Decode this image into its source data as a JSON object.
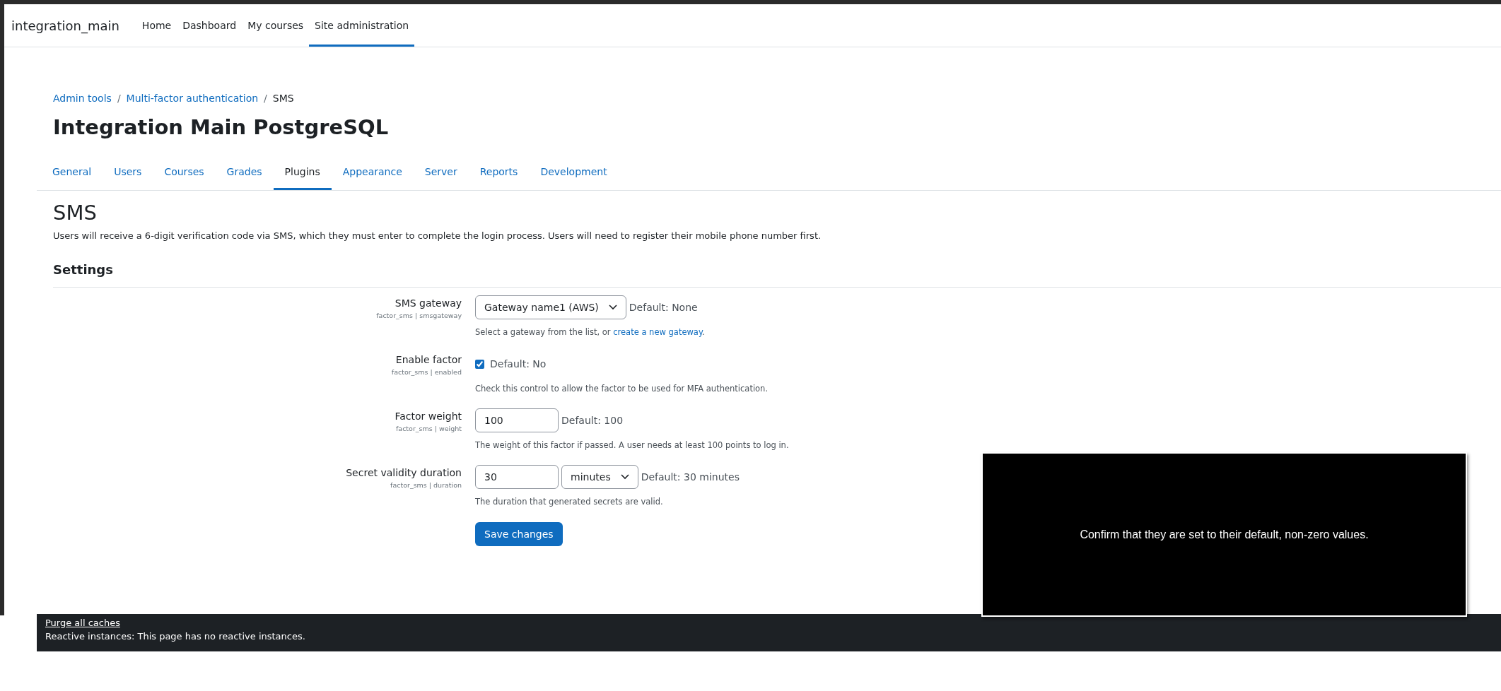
{
  "navbar": {
    "brand": "integration_main",
    "items": [
      {
        "label": "Home",
        "selected": false
      },
      {
        "label": "Dashboard",
        "selected": false
      },
      {
        "label": "My courses",
        "selected": false
      },
      {
        "label": "Site administration",
        "selected": true
      }
    ]
  },
  "breadcrumb": [
    {
      "label": "Admin tools",
      "link": true
    },
    {
      "separator": "/",
      "label": "Multi-factor authentication",
      "link": true
    },
    {
      "separator": "/",
      "label": "SMS",
      "link": false
    }
  ],
  "page_title": "Integration Main PostgreSQL",
  "tabs": [
    {
      "label": "General",
      "selected": false
    },
    {
      "label": "Users",
      "selected": false
    },
    {
      "label": "Courses",
      "selected": false
    },
    {
      "label": "Grades",
      "selected": false
    },
    {
      "label": "Plugins",
      "selected": true
    },
    {
      "label": "Appearance",
      "selected": false
    },
    {
      "label": "Server",
      "selected": false
    },
    {
      "label": "Reports",
      "selected": false
    },
    {
      "label": "Development",
      "selected": false
    }
  ],
  "heading": "SMS",
  "description": "Users will receive a 6-digit verification code via SMS, which they must enter to complete the login process. Users will need to register their mobile phone number first.",
  "section_title": "Settings",
  "settings": [
    {
      "kind": "select",
      "label": "SMS gateway",
      "setting_name": "factor_sms | smsgateway",
      "value": "Gateway name1 (AWS)",
      "default": "Default: None",
      "help": "Select a gateway from the list, or ",
      "help_link": "create a new gateway",
      "help_end": "."
    },
    {
      "kind": "checkbox",
      "label": "Enable factor",
      "setting_name": "factor_sms | enabled",
      "checked": true,
      "default": "Default: No",
      "help": "Check this control to allow the factor to be used for MFA authentication."
    },
    {
      "kind": "text",
      "label": "Factor weight",
      "setting_name": "factor_sms | weight",
      "value": "100",
      "default": "Default: 100",
      "help": "The weight of this factor if passed. A user needs at least 100 points to log in."
    },
    {
      "kind": "duration",
      "label": "Secret validity duration",
      "setting_name": "factor_sms | duration",
      "value": "30",
      "unit": "minutes",
      "default": "Default: 30 minutes",
      "help": "The duration that generated secrets are valid."
    }
  ],
  "save_button": "Save changes",
  "footer": {
    "link": "Purge all caches",
    "text": "Reactive instances: This page has no reactive instances."
  },
  "caption": "Confirm that they are set to their default, non-zero values."
}
